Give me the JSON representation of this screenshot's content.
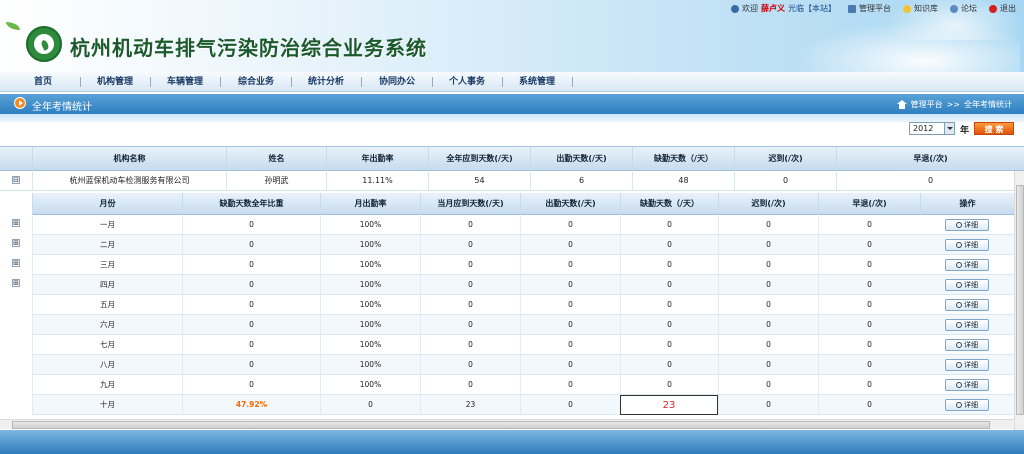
{
  "header": {
    "system_title": "杭州机动车排气污染防治综合业务系统",
    "toplinks": {
      "welcome_prefix": "欢迎",
      "user_name": "薛卢义",
      "user_org": "光临【本站】",
      "platform": "管理平台",
      "knowledge": "知识库",
      "forum": "论坛",
      "logout": "退出"
    }
  },
  "nav": {
    "items": [
      "首页",
      "机构管理",
      "车辆管理",
      "综合业务",
      "统计分析",
      "协同办公",
      "个人事务",
      "系统管理"
    ]
  },
  "breadcrumb": {
    "title": "全年考情统计",
    "path_root": "管理平台",
    "separator": ">>",
    "path_current": "全年考情统计"
  },
  "toolbar": {
    "year_value": "2012",
    "year_suffix": "年",
    "search_label": "搜 索"
  },
  "outer_table": {
    "columns": [
      "机构名称",
      "姓名",
      "年出勤率",
      "全年应到天数(/天)",
      "出勤天数(/天)",
      "缺勤天数（/天）",
      "迟到(/次)",
      "早退(/次)"
    ],
    "row": {
      "expand": "⊟",
      "org": "杭州蓝保机动车检测服务有限公司",
      "name": "孙明武",
      "rate": "11.11%",
      "due": "54",
      "present": "6",
      "absent": "48",
      "late": "0",
      "early": "0"
    },
    "side_expanders": [
      "⊞",
      "⊞",
      "⊞",
      "⊞"
    ]
  },
  "inner_table": {
    "columns": [
      "月份",
      "缺勤天数全年比重",
      "月出勤率",
      "当月应到天数(/天)",
      "出勤天数(/天)",
      "缺勤天数（/天）",
      "迟到(/次)",
      "早退(/次)",
      "操作"
    ],
    "detail_label": "详细",
    "rows": [
      {
        "month": "一月",
        "share": "0",
        "rate": "100%",
        "due": "0",
        "present": "0",
        "absent": "0",
        "late": "0",
        "early": "0"
      },
      {
        "month": "二月",
        "share": "0",
        "rate": "100%",
        "due": "0",
        "present": "0",
        "absent": "0",
        "late": "0",
        "early": "0"
      },
      {
        "month": "三月",
        "share": "0",
        "rate": "100%",
        "due": "0",
        "present": "0",
        "absent": "0",
        "late": "0",
        "early": "0"
      },
      {
        "month": "四月",
        "share": "0",
        "rate": "100%",
        "due": "0",
        "present": "0",
        "absent": "0",
        "late": "0",
        "early": "0"
      },
      {
        "month": "五月",
        "share": "0",
        "rate": "100%",
        "due": "0",
        "present": "0",
        "absent": "0",
        "late": "0",
        "early": "0"
      },
      {
        "month": "六月",
        "share": "0",
        "rate": "100%",
        "due": "0",
        "present": "0",
        "absent": "0",
        "late": "0",
        "early": "0"
      },
      {
        "month": "七月",
        "share": "0",
        "rate": "100%",
        "due": "0",
        "present": "0",
        "absent": "0",
        "late": "0",
        "early": "0"
      },
      {
        "month": "八月",
        "share": "0",
        "rate": "100%",
        "due": "0",
        "present": "0",
        "absent": "0",
        "late": "0",
        "early": "0"
      },
      {
        "month": "九月",
        "share": "0",
        "rate": "100%",
        "due": "0",
        "present": "0",
        "absent": "0",
        "late": "0",
        "early": "0"
      },
      {
        "month": "十月",
        "share": "47.92%",
        "rate": "0",
        "due": "23",
        "present": "0",
        "absent": "23",
        "late": "0",
        "early": "0"
      }
    ]
  },
  "colors": {
    "accent": "#2e7fc0",
    "search": "#f07020",
    "highlight": "#ff6600",
    "absent_red": "#e0202a",
    "alt_row": "#f3f8fc"
  }
}
